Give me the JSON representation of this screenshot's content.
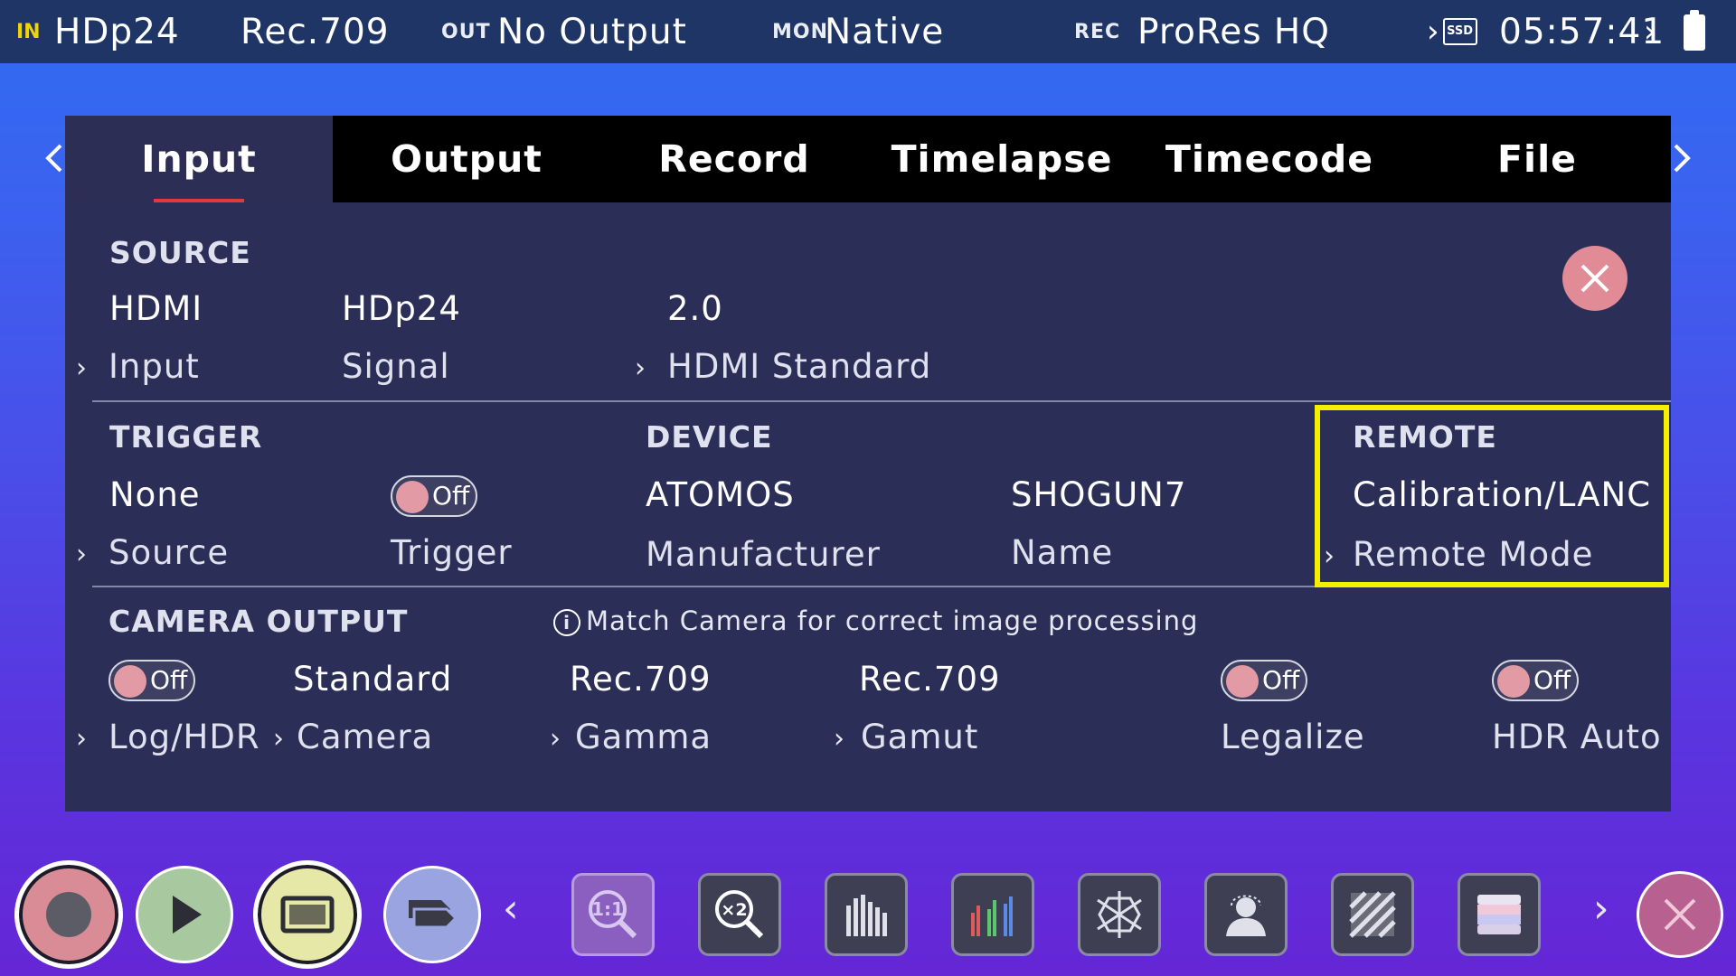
{
  "statusbar": {
    "in_label": "IN",
    "in_value": "HDp24",
    "colorspace": "Rec.709",
    "out_label": "OUT",
    "out_value": "No Output",
    "mon_label": "MON",
    "mon_value": "Native",
    "rec_label": "REC",
    "rec_value": "ProRes HQ",
    "media_label": "SSD",
    "time": "05:57:41"
  },
  "tabs": [
    "Input",
    "Output",
    "Record",
    "Timelapse",
    "Timecode",
    "File"
  ],
  "active_tab": "Input",
  "source": {
    "title": "SOURCE",
    "input_value": "HDMI",
    "input_label": "Input",
    "signal_value": "HDp24",
    "signal_label": "Signal",
    "hdmi_std_value": "2.0",
    "hdmi_std_label": "HDMI Standard"
  },
  "trigger": {
    "title": "TRIGGER",
    "source_value": "None",
    "source_label": "Source",
    "trigger_toggle": "Off",
    "trigger_label": "Trigger"
  },
  "device": {
    "title": "DEVICE",
    "manufacturer_value": "ATOMOS",
    "manufacturer_label": "Manufacturer",
    "name_value": "SHOGUN7",
    "name_label": "Name"
  },
  "remote": {
    "title": "REMOTE",
    "mode_value": "Calibration/LANC",
    "mode_label": "Remote Mode"
  },
  "camera_output": {
    "title": "CAMERA OUTPUT",
    "info": "Match Camera for correct image processing",
    "log_toggle": "Off",
    "log_label": "Log/HDR",
    "camera_value": "Standard",
    "camera_label": "Camera",
    "gamma_value": "Rec.709",
    "gamma_label": "Gamma",
    "gamut_value": "Rec.709",
    "gamut_label": "Gamut",
    "legalize_toggle": "Off",
    "legalize_label": "Legalize",
    "hdr_auto_toggle": "Off",
    "hdr_auto_label": "HDR Auto"
  },
  "colors": {
    "accent_red": "#e03a3f",
    "highlight": "#f4f000",
    "in_label": "#f2d400",
    "statusbar": "#1f3566",
    "panel": "#2b2e56"
  },
  "toolbar_icons": [
    "record-icon",
    "play-icon",
    "monitor-icon",
    "tags-icon",
    "zoom-1-1-icon",
    "zoom-x2-icon",
    "waveform-icon",
    "rgb-parade-icon",
    "vectorscope-icon",
    "focus-peaking-icon",
    "zebra-icon",
    "false-color-icon",
    "close-icon"
  ]
}
